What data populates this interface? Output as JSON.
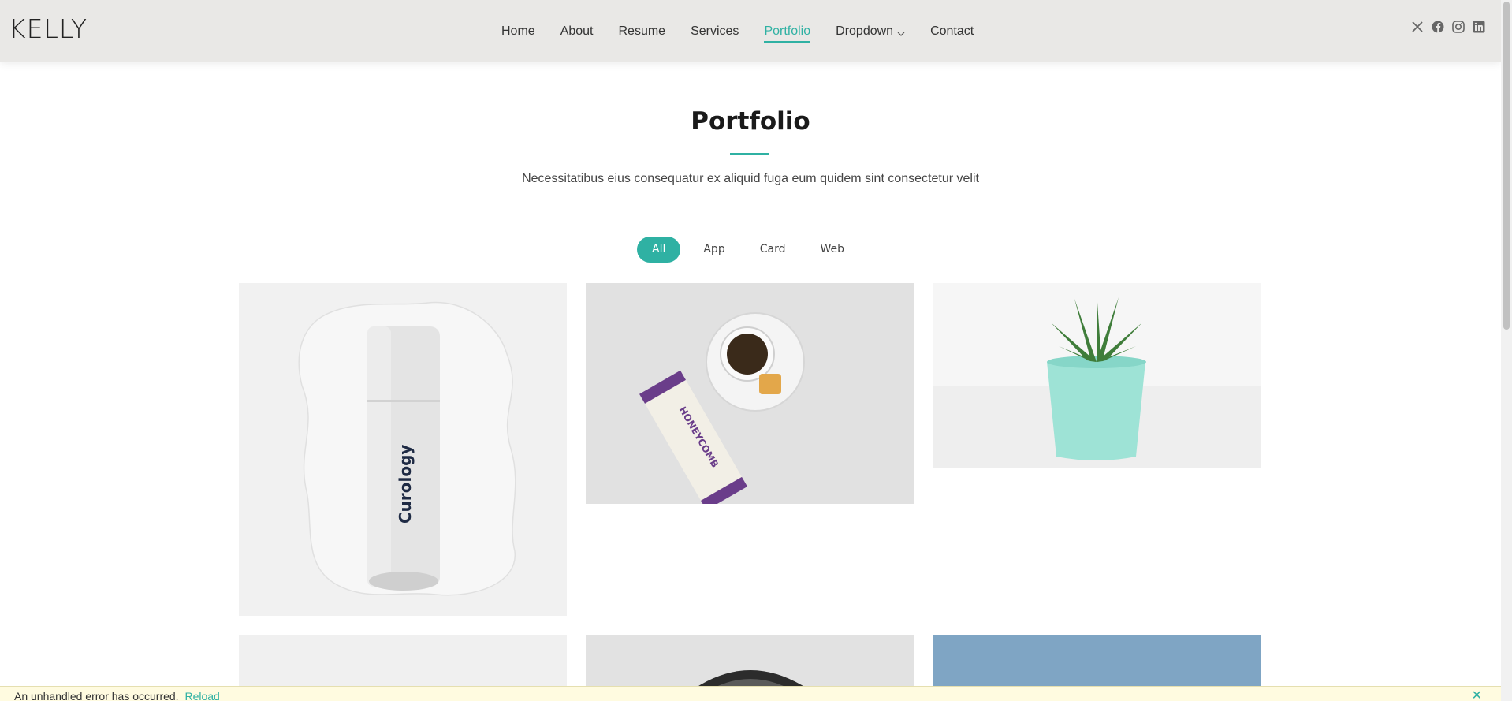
{
  "brand": {
    "logo": "KELLY",
    "accent": "#2fb1a3"
  },
  "nav": {
    "items": [
      {
        "label": "Home"
      },
      {
        "label": "About"
      },
      {
        "label": "Resume"
      },
      {
        "label": "Services"
      },
      {
        "label": "Portfolio",
        "active": true
      },
      {
        "label": "Dropdown",
        "has_submenu": true
      },
      {
        "label": "Contact"
      }
    ]
  },
  "social": [
    "x-icon",
    "facebook-icon",
    "instagram-icon",
    "linkedin-icon"
  ],
  "section": {
    "title": "Portfolio",
    "subtitle": "Necessitatibus eius consequatur ex aliquid fuga eum quidem sint consectetur velit"
  },
  "filters": [
    {
      "label": "All",
      "active": true
    },
    {
      "label": "App"
    },
    {
      "label": "Card"
    },
    {
      "label": "Web"
    }
  ],
  "portfolio": {
    "items": [
      {
        "image": "product-bottle-image",
        "product_text": "Curology"
      },
      {
        "image": "tea-honeycomb-image",
        "product_text": "HONEYCOMB"
      },
      {
        "image": "potted-succulent-image"
      },
      {
        "image": "white-product-image"
      },
      {
        "image": "dark-object-image"
      },
      {
        "image": "blue-sky-image"
      }
    ]
  },
  "error_bar": {
    "message": "An unhandled error has occurred.",
    "link": "Reload",
    "close": "✕"
  }
}
